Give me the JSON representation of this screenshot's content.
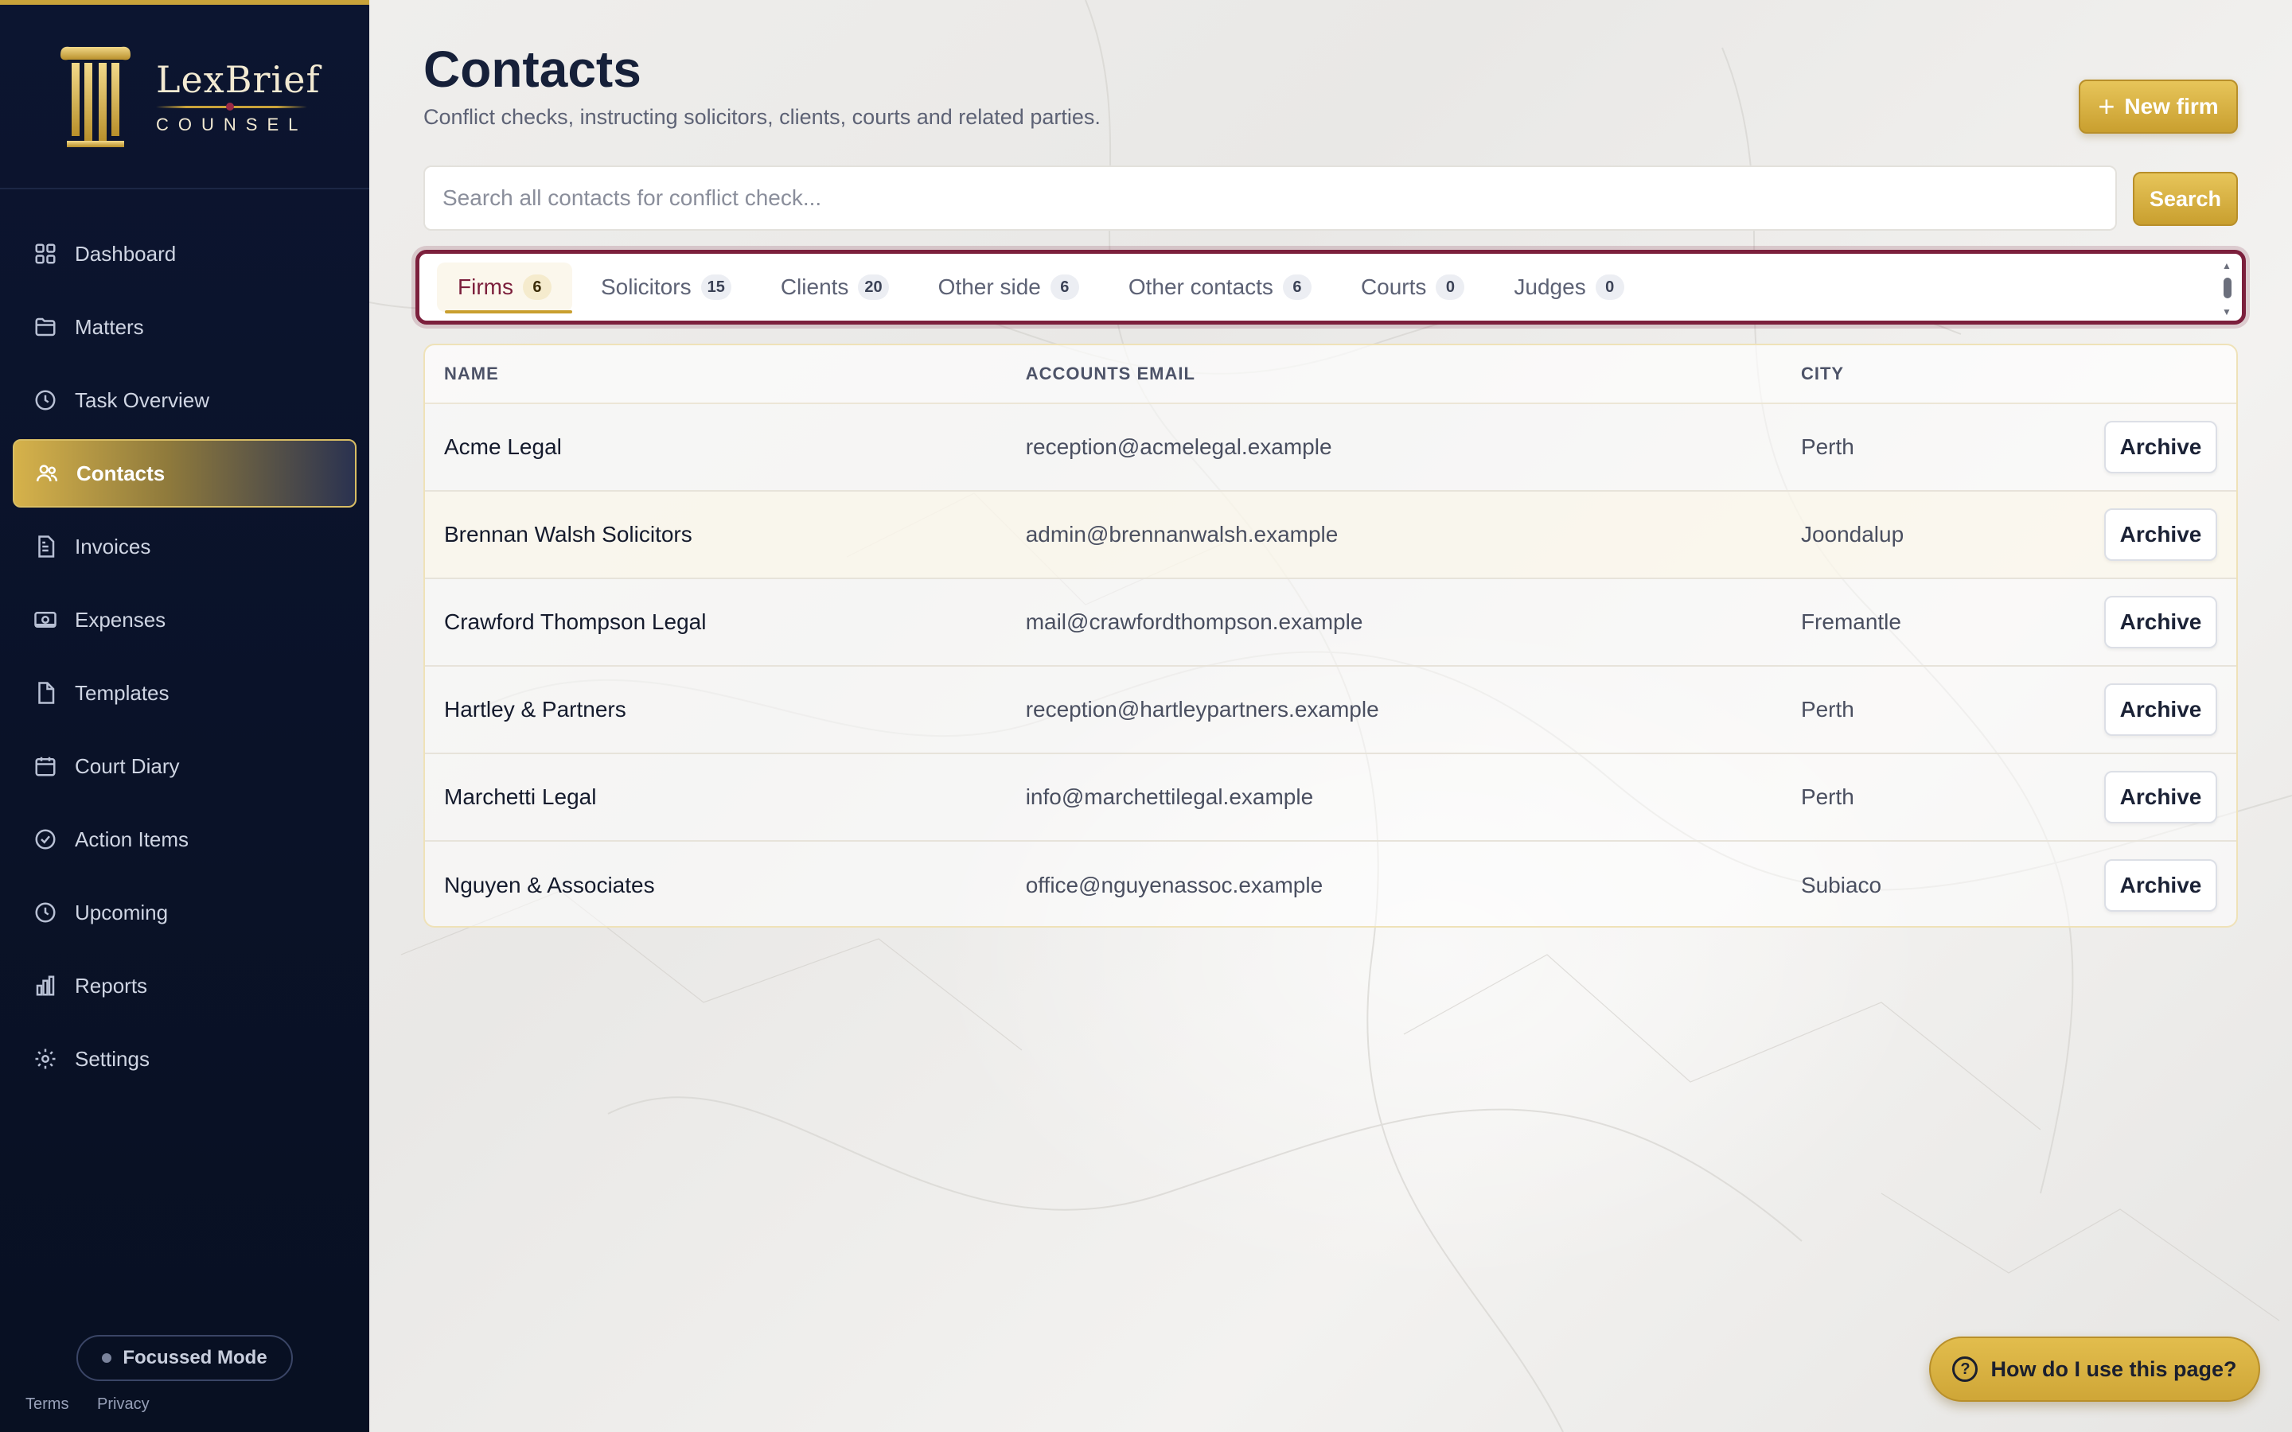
{
  "brand": {
    "name": "LexBrief",
    "sub": "COUNSEL"
  },
  "nav": [
    {
      "label": "Dashboard",
      "icon": "dashboard-icon"
    },
    {
      "label": "Matters",
      "icon": "folder-icon"
    },
    {
      "label": "Task Overview",
      "icon": "clock-icon"
    },
    {
      "label": "Contacts",
      "icon": "users-icon",
      "active": true
    },
    {
      "label": "Invoices",
      "icon": "invoice-icon"
    },
    {
      "label": "Expenses",
      "icon": "banknote-icon"
    },
    {
      "label": "Templates",
      "icon": "file-icon"
    },
    {
      "label": "Court Diary",
      "icon": "calendar-icon"
    },
    {
      "label": "Action Items",
      "icon": "check-circle-icon"
    },
    {
      "label": "Upcoming",
      "icon": "clock-icon"
    },
    {
      "label": "Reports",
      "icon": "bar-chart-icon"
    },
    {
      "label": "Settings",
      "icon": "gear-icon"
    }
  ],
  "focus_mode": "Focussed Mode",
  "legal": {
    "terms": "Terms",
    "privacy": "Privacy"
  },
  "page": {
    "title": "Contacts",
    "subtitle": "Conflict checks, instructing solicitors, clients, courts and related parties.",
    "new_button": "New firm"
  },
  "search": {
    "placeholder": "Search all contacts for conflict check...",
    "value": "",
    "button": "Search"
  },
  "tabs": [
    {
      "label": "Firms",
      "count": "6",
      "active": true
    },
    {
      "label": "Solicitors",
      "count": "15"
    },
    {
      "label": "Clients",
      "count": "20"
    },
    {
      "label": "Other side",
      "count": "6"
    },
    {
      "label": "Other contacts",
      "count": "6"
    },
    {
      "label": "Courts",
      "count": "0"
    },
    {
      "label": "Judges",
      "count": "0"
    }
  ],
  "table": {
    "columns": {
      "name": "NAME",
      "email": "ACCOUNTS EMAIL",
      "city": "CITY"
    },
    "rows": [
      {
        "name": "Acme Legal",
        "email": "reception@acmelegal.example",
        "city": "Perth",
        "action": "Archive"
      },
      {
        "name": "Brennan Walsh Solicitors",
        "email": "admin@brennanwalsh.example",
        "city": "Joondalup",
        "action": "Archive"
      },
      {
        "name": "Crawford Thompson Legal",
        "email": "mail@crawfordthompson.example",
        "city": "Fremantle",
        "action": "Archive"
      },
      {
        "name": "Hartley & Partners",
        "email": "reception@hartleypartners.example",
        "city": "Perth",
        "action": "Archive"
      },
      {
        "name": "Marchetti Legal",
        "email": "info@marchettilegal.example",
        "city": "Perth",
        "action": "Archive"
      },
      {
        "name": "Nguyen & Associates",
        "email": "office@nguyenassoc.example",
        "city": "Subiaco",
        "action": "Archive"
      }
    ]
  },
  "help_button": "How do I use this page?",
  "colors": {
    "accent_gold": "#c99f2f",
    "accent_maroon": "#7c1f3c",
    "sidebar_navy": "#0a1228"
  }
}
